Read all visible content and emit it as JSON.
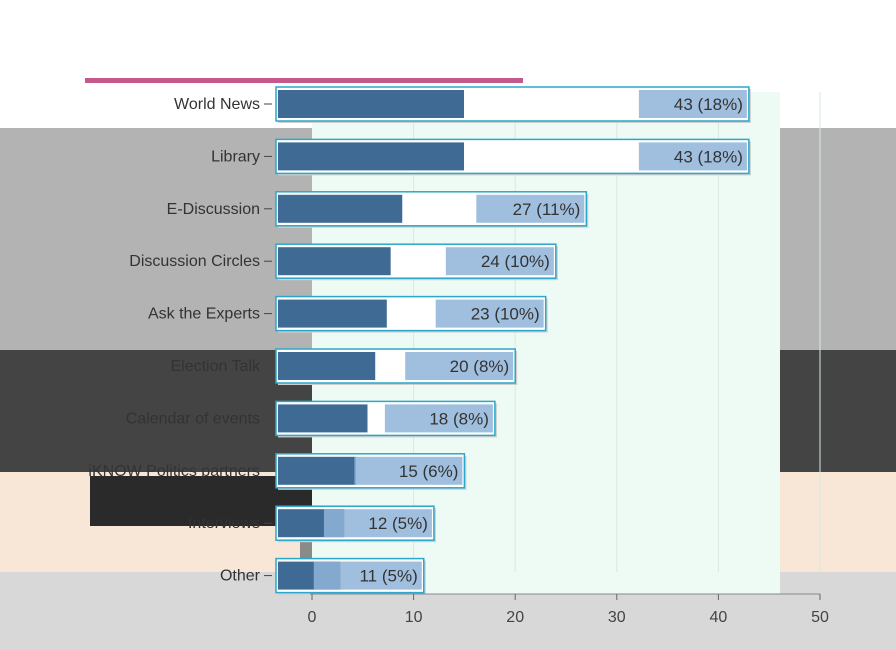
{
  "chart_data": {
    "type": "bar",
    "orientation": "horizontal",
    "title": "",
    "subtitle": "",
    "xlabel": "",
    "ylabel": "",
    "xlim": [
      0,
      50
    ],
    "xticks": [
      "0",
      "10",
      "20",
      "30",
      "40",
      "50"
    ],
    "grid": true,
    "categories": [
      "World News",
      "Library",
      "E-Discussion",
      "Discussion Circles",
      "Ask the Experts",
      "Election Talk",
      "Calendar of events",
      "iKNOW Politics partners",
      "Interviews",
      "Other"
    ],
    "values": [
      43,
      43,
      27,
      24,
      23,
      20,
      18,
      15,
      12,
      11
    ],
    "data_labels": [
      "43 (18%)",
      "43 (18%)",
      "27 (11%)",
      "24 (10%)",
      "23 (10%)",
      "20 (8%)",
      "18 (8%)",
      "15 (6%)",
      "12 (5%)",
      "11 (5%)"
    ],
    "colors": {
      "bar_dark": "#3f6a93",
      "bar_light": "#8fb4d8",
      "bar_edge": "#2aa7c9",
      "plot_bg": "#eefaf4",
      "grid": "#d9e8e2"
    }
  }
}
